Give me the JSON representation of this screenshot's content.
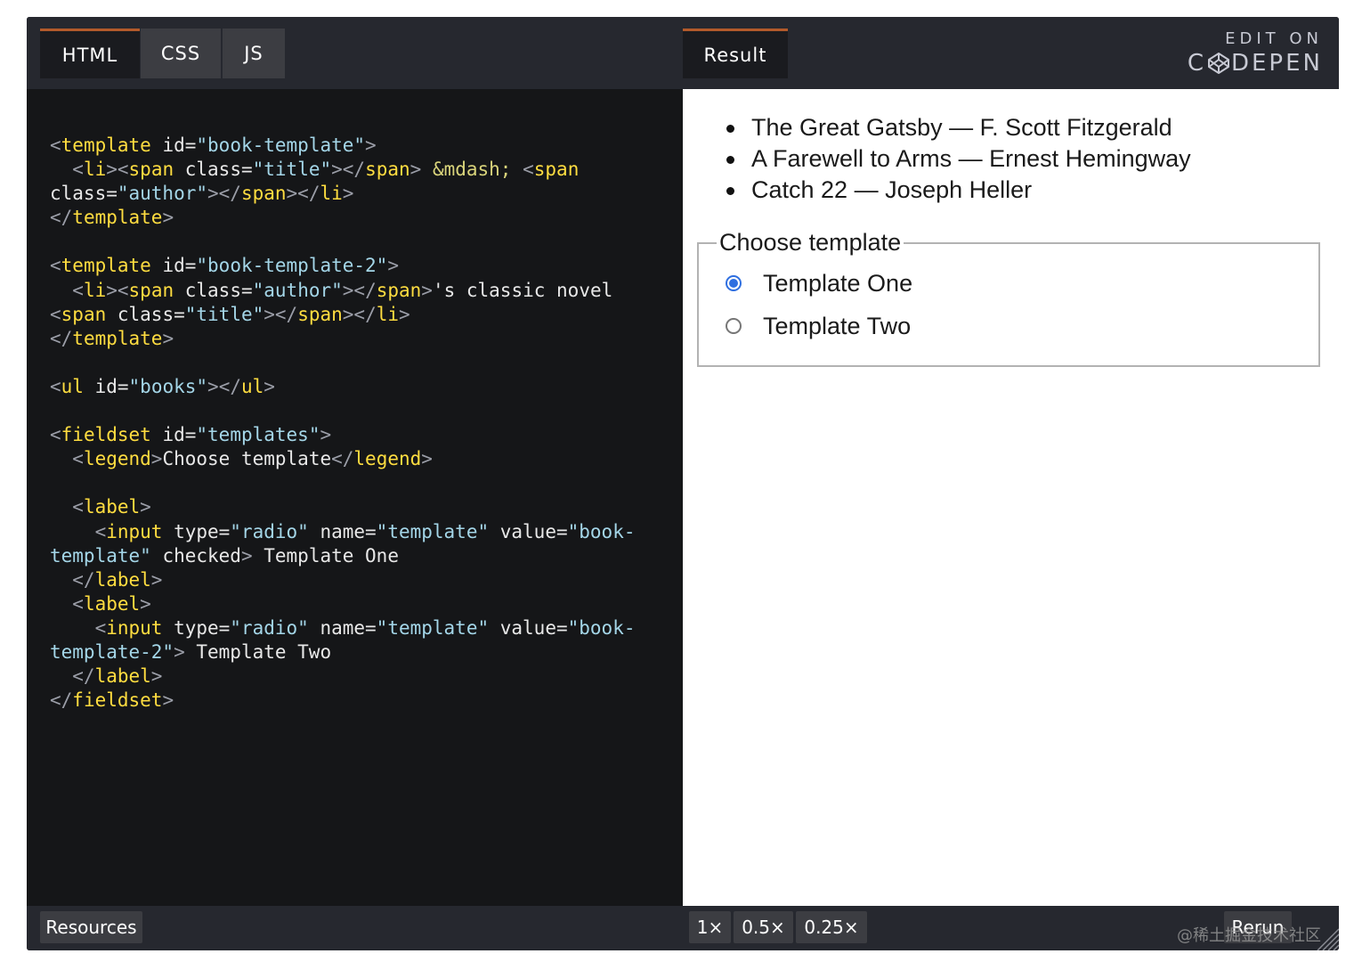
{
  "tabs": {
    "html": "HTML",
    "css": "CSS",
    "js": "JS",
    "result": "Result"
  },
  "branding": {
    "edit_on": "EDIT ON",
    "codepen_c": "C",
    "codepen_rest": "DEPEN",
    "logo_icon": "codepen-icon"
  },
  "code": {
    "l1": {
      "a": "<",
      "b": "template",
      "c": " id=",
      "d": "\"book-template\"",
      "e": ">"
    },
    "l2": {
      "a": "  <",
      "b": "li",
      "c": "><",
      "d": "span",
      "e": " class=",
      "f": "\"title\"",
      "g": "></",
      "h": "span",
      "i": "> ",
      "j": "&mdash;",
      "k": " <",
      "l": "span"
    },
    "l3": {
      "a": "class=",
      "b": "\"author\"",
      "c": "></",
      "d": "span",
      "e": "></",
      "f": "li",
      "g": ">"
    },
    "l4": {
      "a": "</",
      "b": "template",
      "c": ">"
    },
    "l5": {
      "a": "<",
      "b": "template",
      "c": " id=",
      "d": "\"book-template-2\"",
      "e": ">"
    },
    "l6": {
      "a": "  <",
      "b": "li",
      "c": "><",
      "d": "span",
      "e": " class=",
      "f": "\"author\"",
      "g": "></",
      "h": "span",
      "i": ">",
      "j": "'s classic novel"
    },
    "l7": {
      "a": "<",
      "b": "span",
      "c": " class=",
      "d": "\"title\"",
      "e": "></",
      "f": "span",
      "g": "></",
      "h": "li",
      "i": ">"
    },
    "l8": {
      "a": "</",
      "b": "template",
      "c": ">"
    },
    "l9": {
      "a": "<",
      "b": "ul",
      "c": " id=",
      "d": "\"books\"",
      "e": "></",
      "f": "ul",
      "g": ">"
    },
    "l10": {
      "a": "<",
      "b": "fieldset",
      "c": " id=",
      "d": "\"templates\"",
      "e": ">"
    },
    "l11": {
      "a": "  <",
      "b": "legend",
      "c": ">",
      "d": "Choose template",
      "e": "</",
      "f": "legend",
      "g": ">"
    },
    "l12": {
      "a": "  <",
      "b": "label",
      "c": ">"
    },
    "l13": {
      "a": "    <",
      "b": "input",
      "c": " type=",
      "d": "\"radio\"",
      "e": " name=",
      "f": "\"template\"",
      "g": " value=",
      "h": "\"book-"
    },
    "l14": {
      "a": "template\"",
      "b": " checked",
      "c": ">",
      "d": " Template One"
    },
    "l15": {
      "a": "  </",
      "b": "label",
      "c": ">"
    },
    "l16": {
      "a": "  <",
      "b": "label",
      "c": ">"
    },
    "l17": {
      "a": "    <",
      "b": "input",
      "c": " type=",
      "d": "\"radio\"",
      "e": " name=",
      "f": "\"template\"",
      "g": " value=",
      "h": "\"book-"
    },
    "l18": {
      "a": "template-2\"",
      "b": ">",
      "c": " Template Two"
    },
    "l19": {
      "a": "  </",
      "b": "label",
      "c": ">"
    },
    "l20": {
      "a": "</",
      "b": "fieldset",
      "c": ">"
    }
  },
  "result": {
    "books": [
      "The Great Gatsby — F. Scott Fitzgerald",
      "A Farewell to Arms — Ernest Hemingway",
      "Catch 22 — Joseph Heller"
    ],
    "legend": "Choose template",
    "options": [
      {
        "label": "Template One",
        "checked": true
      },
      {
        "label": "Template Two",
        "checked": false
      }
    ]
  },
  "footer": {
    "resources": "Resources",
    "zoom": [
      "1×",
      "0.5×",
      "0.25×"
    ],
    "rerun": "Rerun"
  },
  "watermark": "@稀土掘金技术社区",
  "colors": {
    "tag": "#ffdd40",
    "string": "#a4d6e8",
    "bracket": "#9b9ea8",
    "active_tab_accent": "#b35a2b",
    "radio_accent": "#2f6fe0"
  }
}
